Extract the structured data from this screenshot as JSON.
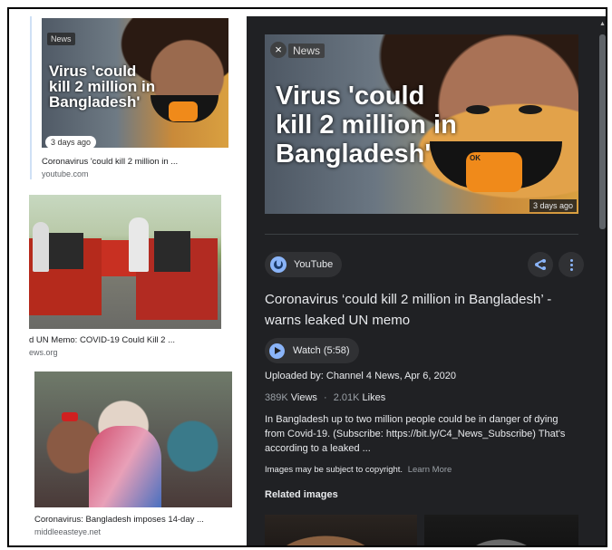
{
  "results": [
    {
      "news_tag": "News",
      "headline": "Virus 'could kill 2 million in Bangladesh'",
      "age": "3 days ago",
      "caption": "Coronavirus 'could kill 2 million in ...",
      "source": "youtube.com"
    },
    {
      "caption": "d UN Memo: COVID-19 Could Kill 2 ...",
      "source": "ews.org"
    },
    {
      "caption": "Coronavirus: Bangladesh imposes 14-day ...",
      "source": "middleeasteye.net"
    }
  ],
  "detail": {
    "news_tag": "News",
    "close_glyph": "×",
    "headline": "Virus 'could kill 2 million in Bangladesh'",
    "age": "3 days ago",
    "source_name": "YouTube",
    "title": "Coronavirus ‘could kill 2 million in Bangladesh’ - warns leaked UN memo",
    "watch_label": "Watch (5:58)",
    "uploaded": "Uploaded by: Channel 4 News, Apr 6, 2020",
    "views_num": "389K",
    "views_label": "Views",
    "likes_num": "2.01K",
    "likes_label": "Likes",
    "separator": "·",
    "description": "In Bangladesh up to two million people could be in danger of dying from Covid-19. (Subscribe: https://bit.ly/C4_News_Subscribe) That's according to a leaked ...",
    "copyright": "Images may be subject to copyright.",
    "learn_more": "Learn More",
    "related_heading": "Related images"
  },
  "scroll_up_glyph": "▲",
  "colors": {
    "panel_bg": "#202124",
    "chip_bg": "#303134",
    "accent_blue": "#8ab4f8",
    "muted_text": "#9aa0a6"
  },
  "icons": [
    "globe-icon",
    "share-icon",
    "more-vert-icon",
    "play-icon",
    "close-icon"
  ]
}
